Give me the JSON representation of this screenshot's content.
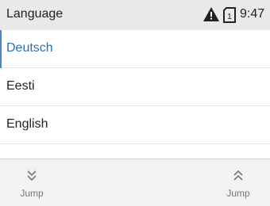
{
  "status_bar": {
    "title": "Language",
    "time": "9:47",
    "icons": [
      "warning-icon",
      "sim-card-icon"
    ],
    "sim_number": "1"
  },
  "list": {
    "items": [
      {
        "label": "Deutsch",
        "selected": true
      },
      {
        "label": "Eesti",
        "selected": false
      },
      {
        "label": "English",
        "selected": false
      }
    ]
  },
  "footer": {
    "left_label": "Jump",
    "right_label": "Jump",
    "left_icon": "chevron-double-down-icon",
    "right_icon": "chevron-double-up-icon"
  },
  "colors": {
    "accent": "#4a86c8",
    "status_bar_bg": "#e9e9e9",
    "footer_bg": "#f2f2f2"
  }
}
